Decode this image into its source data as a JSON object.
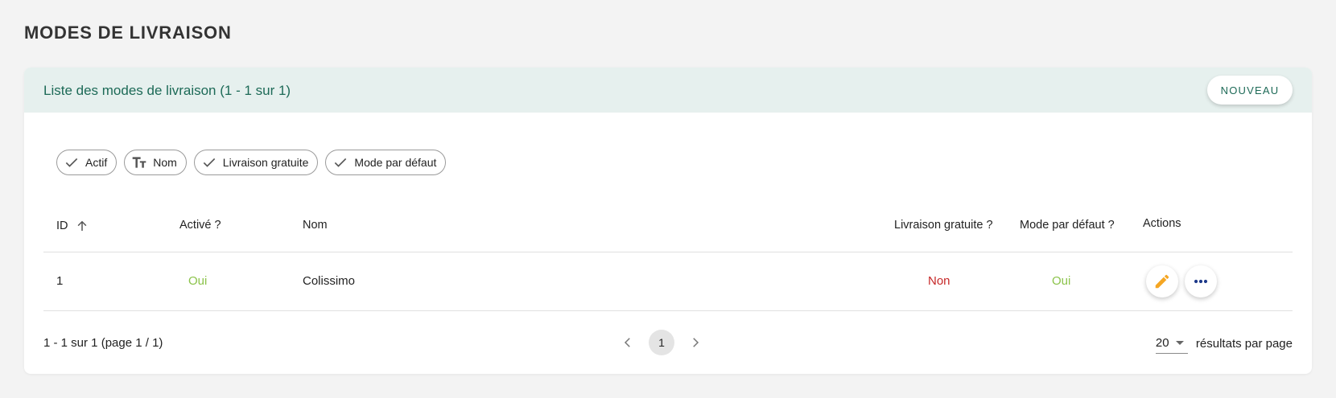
{
  "page": {
    "title": "MODES DE LIVRAISON"
  },
  "card": {
    "header_title": "Liste des modes de livraison (1 - 1 sur 1)",
    "new_button_label": "NOUVEAU"
  },
  "filters": [
    {
      "label": "Actif",
      "icon": "check-icon"
    },
    {
      "label": "Nom",
      "icon": "text-format-icon"
    },
    {
      "label": "Livraison gratuite",
      "icon": "check-icon"
    },
    {
      "label": "Mode par défaut",
      "icon": "check-icon"
    }
  ],
  "table": {
    "columns": [
      "ID",
      "Activé ?",
      "Nom",
      "Livraison gratuite ?",
      "Mode par défaut ?",
      "Actions"
    ],
    "sort_icon": "arrow-up-icon",
    "rows": [
      {
        "id": "1",
        "active": "Oui",
        "name": "Colissimo",
        "free_delivery": "Non",
        "default_mode": "Oui"
      }
    ]
  },
  "footer": {
    "count_text": "1 - 1 sur 1 (page 1 / 1)",
    "current_page": "1",
    "per_page_value": "20",
    "per_page_label": "résultats par page"
  },
  "colors": {
    "accent": "#1d6a57",
    "yes": "#8bc34a",
    "no": "#c62828",
    "edit_icon": "#f5a623",
    "more_icon": "#1e3a8a"
  }
}
